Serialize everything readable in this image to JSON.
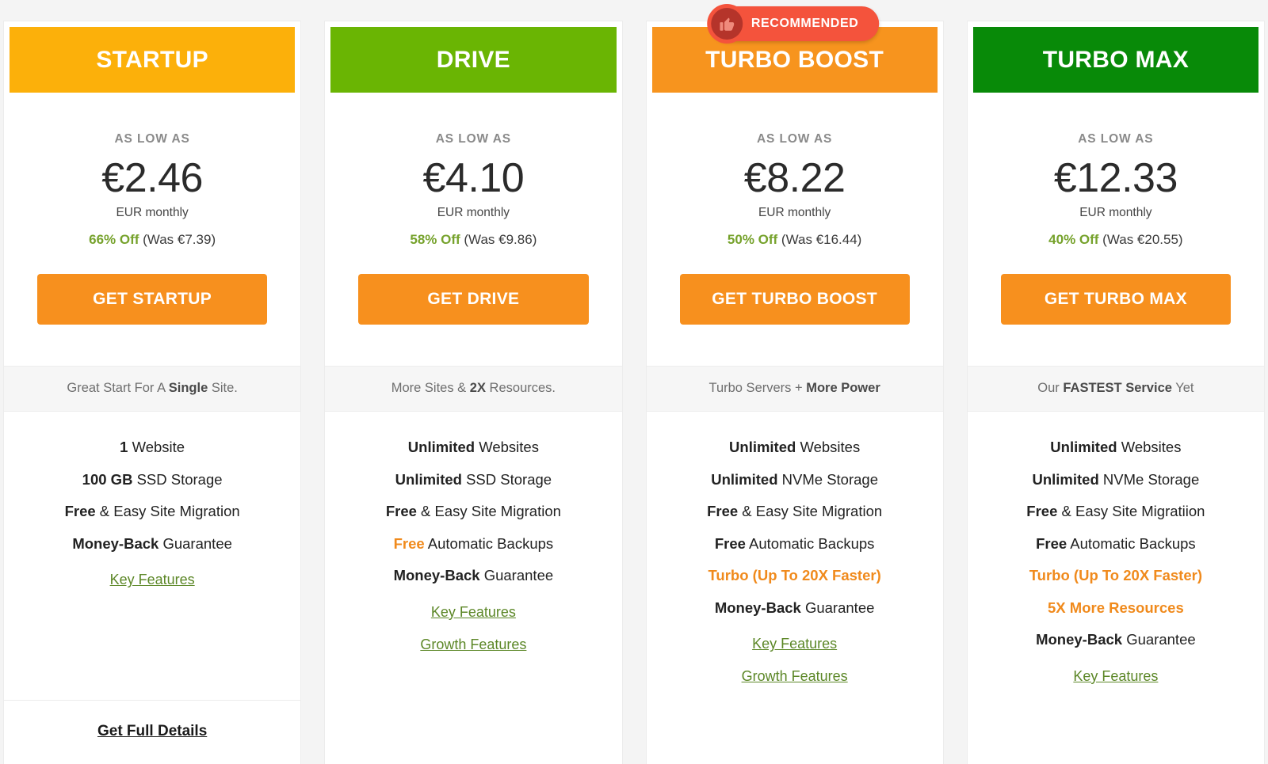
{
  "page": {
    "background": "#f4f4f4",
    "currency_symbol": "€"
  },
  "badge": {
    "label": "RECOMMENDED",
    "icon": "thumbs-up-icon",
    "pill_color": "#f4533c",
    "circle_color": "#b5342a"
  },
  "common": {
    "as_low_as": "AS LOW AS",
    "period": "EUR monthly",
    "key_features_label": "Key Features",
    "growth_features_label": "Growth Features",
    "full_details_label": "Get Full Details"
  },
  "plans": [
    {
      "id": "startup",
      "name": "STARTUP",
      "header_color": "#fcb00a",
      "as_low_as": "AS LOW AS",
      "price": "€2.46",
      "period": "EUR monthly",
      "discount_pct": "66% Off",
      "discount_was": " (Was €7.39)",
      "cta_label": "GET STARTUP",
      "cta_color": "#f7901e",
      "tagline_pre": "Great Start For A ",
      "tagline_bold": "Single",
      "tagline_post": " Site.",
      "features": [
        {
          "bold": "1",
          "rest": " Website",
          "style": "normal"
        },
        {
          "bold": "100 GB",
          "rest": " SSD Storage",
          "style": "normal"
        },
        {
          "bold": "Free",
          "rest": " & Easy Site Migration",
          "style": "normal"
        },
        {
          "bold": "Money-Back",
          "rest": " Guarantee",
          "style": "normal"
        }
      ],
      "links": [
        "Key Features"
      ],
      "has_full_details": true,
      "full_details_label": "Get Full Details",
      "recommended": false
    },
    {
      "id": "drive",
      "name": "DRIVE",
      "header_color": "#6ab503",
      "as_low_as": "AS LOW AS",
      "price": "€4.10",
      "period": "EUR monthly",
      "discount_pct": "58% Off",
      "discount_was": " (Was €9.86)",
      "cta_label": "GET DRIVE",
      "cta_color": "#f7901e",
      "tagline_pre": "More Sites & ",
      "tagline_bold": "2X",
      "tagline_post": " Resources.",
      "features": [
        {
          "bold": "Unlimited",
          "rest": " Websites",
          "style": "normal"
        },
        {
          "bold": "Unlimited",
          "rest": " SSD Storage",
          "style": "normal"
        },
        {
          "bold": "Free",
          "rest": " & Easy Site Migration",
          "style": "normal"
        },
        {
          "bold": "Free",
          "rest": " Automatic Backups",
          "style": "orange-bold-lead"
        },
        {
          "bold": "Money-Back",
          "rest": " Guarantee",
          "style": "normal"
        }
      ],
      "links": [
        "Key Features",
        "Growth Features"
      ],
      "has_full_details": false,
      "full_details_label": "",
      "recommended": false
    },
    {
      "id": "turbo-boost",
      "name": "TURBO BOOST",
      "header_color": "#f7941e",
      "as_low_as": "AS LOW AS",
      "price": "€8.22",
      "period": "EUR monthly",
      "discount_pct": "50% Off",
      "discount_was": " (Was €16.44)",
      "cta_label": "GET TURBO BOOST",
      "cta_color": "#f7901e",
      "tagline_pre": "Turbo Servers + ",
      "tagline_bold": "More Power",
      "tagline_post": "",
      "features": [
        {
          "bold": "Unlimited",
          "rest": " Websites",
          "style": "normal"
        },
        {
          "bold": "Unlimited",
          "rest": " NVMe Storage",
          "style": "normal"
        },
        {
          "bold": "Free",
          "rest": " & Easy Site Migration",
          "style": "normal"
        },
        {
          "bold": "Free",
          "rest": " Automatic Backups",
          "style": "normal"
        },
        {
          "bold": "Turbo (Up To 20X Faster)",
          "rest": "",
          "style": "all-orange"
        },
        {
          "bold": "Money-Back",
          "rest": " Guarantee",
          "style": "normal"
        }
      ],
      "links": [
        "Key Features",
        "Growth Features"
      ],
      "has_full_details": false,
      "full_details_label": "",
      "recommended": true
    },
    {
      "id": "turbo-max",
      "name": "TURBO MAX",
      "header_color": "#088a08",
      "as_low_as": "AS LOW AS",
      "price": "€12.33",
      "period": "EUR monthly",
      "discount_pct": "40% Off",
      "discount_was": " (Was €20.55)",
      "cta_label": "GET TURBO MAX",
      "cta_color": "#f7901e",
      "tagline_pre": "Our ",
      "tagline_bold": "FASTEST Service",
      "tagline_post": " Yet",
      "features": [
        {
          "bold": "Unlimited",
          "rest": " Websites",
          "style": "normal"
        },
        {
          "bold": "Unlimited",
          "rest": " NVMe Storage",
          "style": "normal"
        },
        {
          "bold": "Free",
          "rest": " & Easy Site Migratiion",
          "style": "normal"
        },
        {
          "bold": "Free",
          "rest": " Automatic Backups",
          "style": "normal"
        },
        {
          "bold": "Turbo (Up To 20X Faster)",
          "rest": "",
          "style": "all-orange"
        },
        {
          "bold": "5X More Resources",
          "rest": "",
          "style": "all-orange"
        },
        {
          "bold": "Money-Back",
          "rest": " Guarantee",
          "style": "normal"
        }
      ],
      "links": [
        "Key Features"
      ],
      "has_full_details": false,
      "full_details_label": "",
      "recommended": false
    }
  ]
}
